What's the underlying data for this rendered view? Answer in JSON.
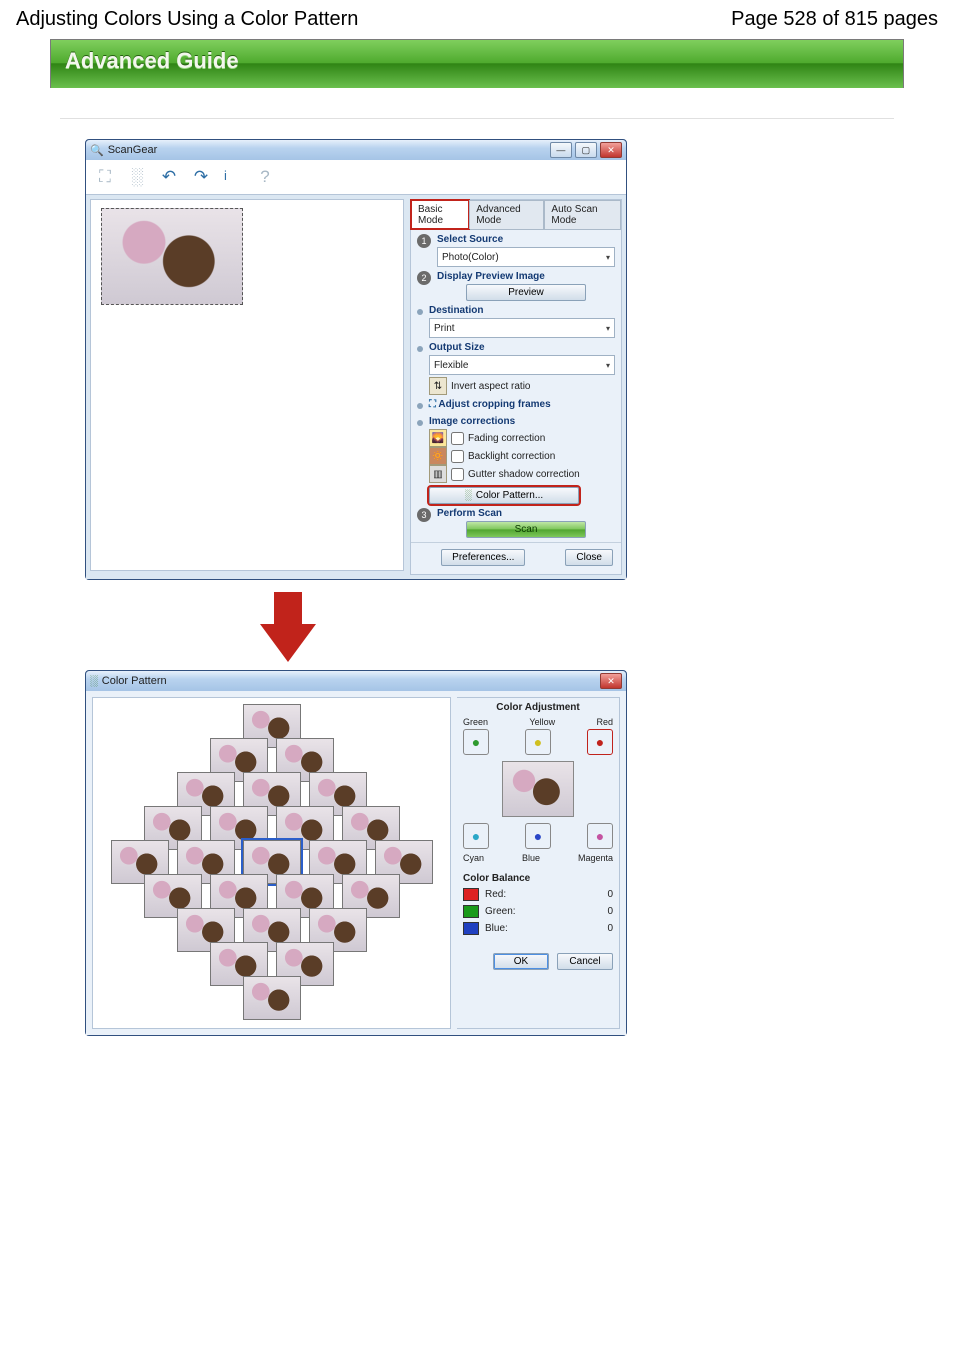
{
  "header": {
    "left": "Adjusting Colors Using a Color Pattern",
    "right": "Page 528 of 815 pages"
  },
  "banner": {
    "title": "Advanced Guide"
  },
  "scangear": {
    "title": "ScanGear",
    "tabs": {
      "basic": "Basic Mode",
      "adv": "Advanced Mode",
      "auto": "Auto Scan Mode"
    },
    "steps": {
      "n1": "1",
      "n2": "2",
      "n3": "3",
      "select_source": "Select Source",
      "select_source_value": "Photo(Color)",
      "display_preview": "Display Preview Image",
      "preview_btn": "Preview",
      "destination": "Destination",
      "destination_value": "Print",
      "output_size": "Output Size",
      "output_value": "Flexible",
      "invert_ar": "Invert aspect ratio",
      "adjust_crop": "Adjust cropping frames",
      "image_corr": "Image corrections",
      "fading": "Fading correction",
      "backlight": "Backlight correction",
      "gutter": "Gutter shadow correction",
      "color_pattern_btn": "Color Pattern...",
      "perform_scan": "Perform Scan",
      "scan_btn": "Scan"
    },
    "footer": {
      "prefs": "Preferences...",
      "close": "Close"
    }
  },
  "color_pattern_dialog": {
    "title": "Color Pattern",
    "adjustment_title": "Color Adjustment",
    "axis": {
      "green": "Green",
      "yellow": "Yellow",
      "red": "Red",
      "cyan": "Cyan",
      "blue": "Blue",
      "magenta": "Magenta"
    },
    "balance_title": "Color Balance",
    "balance": {
      "red_label": "Red:",
      "red_val": "0",
      "green_label": "Green:",
      "green_val": "0",
      "blue_label": "Blue:",
      "blue_val": "0"
    },
    "ok": "OK",
    "cancel": "Cancel"
  }
}
